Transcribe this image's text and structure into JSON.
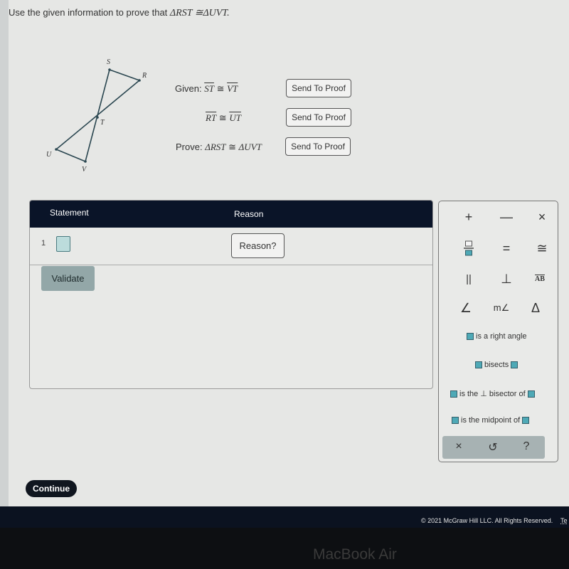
{
  "instruction": {
    "text": "Use the given information to prove that",
    "statement": "ΔRST ≅ΔUVT."
  },
  "diagram": {
    "labels": {
      "S": "S",
      "R": "R",
      "T": "T",
      "U": "U",
      "V": "V"
    }
  },
  "givens": [
    {
      "prefix": "Given:",
      "left": "ST",
      "symbol": "≅",
      "right": "VT",
      "button": "Send To Proof"
    },
    {
      "prefix": "",
      "left": "RT",
      "symbol": "≅",
      "right": "UT",
      "button": "Send To Proof"
    },
    {
      "prefix": "Prove:",
      "left": "ΔRST",
      "symbol": "≅",
      "right": "ΔUVT",
      "button": "Send To Proof"
    }
  ],
  "proof_table": {
    "headers": {
      "statement": "Statement",
      "reason": "Reason"
    },
    "rows": [
      {
        "num": "1",
        "reason_button": "Reason?"
      }
    ],
    "validate_label": "Validate"
  },
  "palette": {
    "keys": [
      {
        "name": "plus",
        "glyph": "+"
      },
      {
        "name": "minus",
        "glyph": "—"
      },
      {
        "name": "times",
        "glyph": "×"
      },
      {
        "name": "fraction",
        "glyph": ""
      },
      {
        "name": "equals",
        "glyph": "="
      },
      {
        "name": "congruent",
        "glyph": "≅"
      },
      {
        "name": "parallel",
        "glyph": "||"
      },
      {
        "name": "perpendicular",
        "glyph": "⊥"
      },
      {
        "name": "segment",
        "glyph": "AB"
      },
      {
        "name": "angle",
        "glyph": "∠"
      },
      {
        "name": "angle-measure",
        "glyph": "m∠"
      },
      {
        "name": "triangle",
        "glyph": "Δ"
      }
    ],
    "phrases": {
      "right_angle": "is a right angle",
      "bisects": "bisects",
      "perp_bisector_a": "is the",
      "perp_symbol": "⊥",
      "perp_bisector_b": "bisector of",
      "midpoint": "is the midpoint of"
    },
    "footer": {
      "close": "×",
      "undo": "↺",
      "help": "?"
    }
  },
  "continue_label": "Continue",
  "footer": {
    "copyright": "© 2021 McGraw Hill LLC. All Rights Reserved.",
    "terms_partial": "Te"
  },
  "bezel_label": "MacBook Air"
}
